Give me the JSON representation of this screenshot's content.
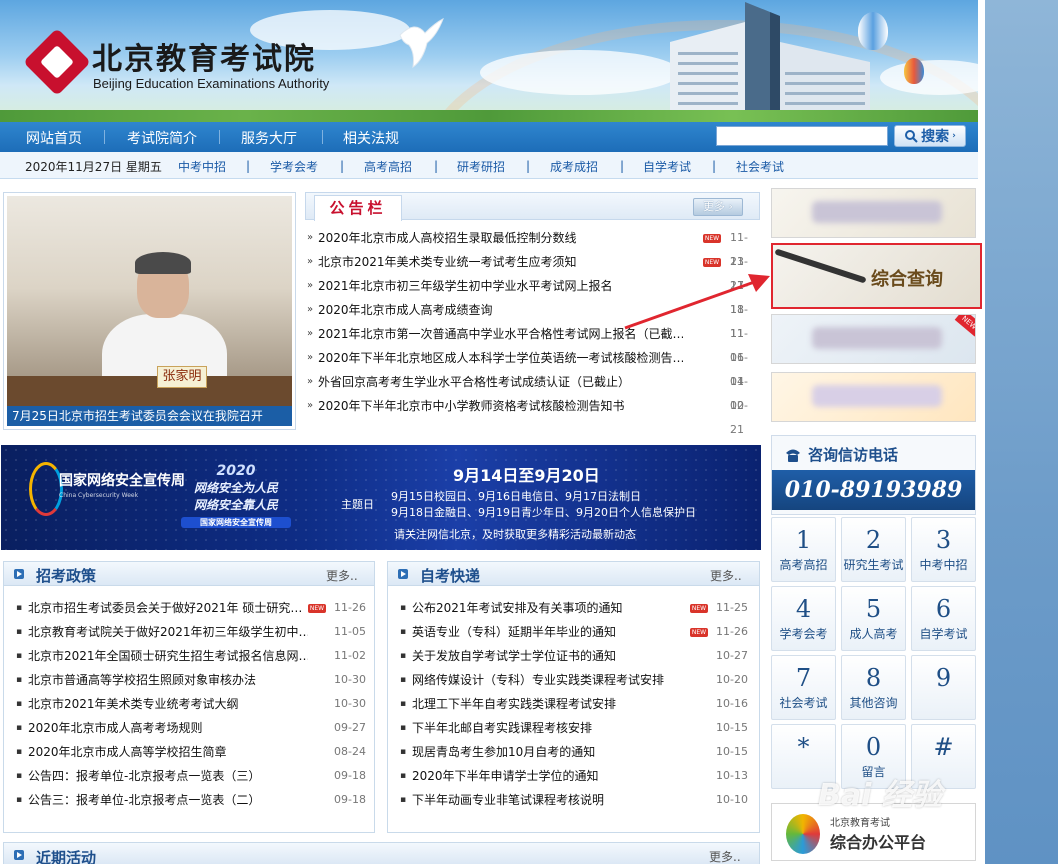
{
  "header": {
    "logo_cn": "北京教育考试院",
    "logo_en": "Beijing Education Examinations Authority"
  },
  "nav": {
    "items": [
      "网站首页",
      "考试院简介",
      "服务大厅",
      "相关法规"
    ],
    "search_placeholder": "",
    "search_label": "搜索"
  },
  "subnav": {
    "date": "2020年11月27日 星期五",
    "items": [
      "中考中招",
      "学考会考",
      "高考高招",
      "研考研招",
      "成考成招",
      "自学考试",
      "社会考试"
    ]
  },
  "photo": {
    "nameplate": "张家明",
    "caption": "7月25日北京市招生考试委员会会议在我院召开"
  },
  "bulletin": {
    "title": "公告栏",
    "more": "更多",
    "items": [
      {
        "title": "2020年北京市成人高校招生录取最低控制分数线",
        "date": "11-23",
        "new": true
      },
      {
        "title": "北京市2021年美术类专业统一考试考生应考须知",
        "date": "11-27",
        "new": true
      },
      {
        "title": "2021年北京市初三年级学生初中学业水平考试网上报名",
        "date": "11-18",
        "new": false
      },
      {
        "title": "2020年北京市成人高考成绩查询",
        "date": "11-11",
        "new": false
      },
      {
        "title": "2021年北京市第一次普通高中学业水平合格性考试网上报名（已截…",
        "date": "11-06",
        "new": false
      },
      {
        "title": "2020年下半年北京地区成人本科学士学位英语统一考试核酸检测告…",
        "date": "11-04",
        "new": false
      },
      {
        "title": "外省回京高考考生学业水平合格性考试成绩认证（已截止）",
        "date": "11-02",
        "new": false
      },
      {
        "title": "2020年下半年北京市中小学教师资格考试核酸检测告知书",
        "date": "10-21",
        "new": false
      }
    ]
  },
  "right_cards": {
    "query_label": "综合查询",
    "new_tag": "NEW"
  },
  "ad": {
    "logo1": "国家网络安全宣传周",
    "logo1_sub": "China Cybersecurity Week",
    "logo2_year": "2020",
    "logo2_line1": "网络安全为人民",
    "logo2_line2": "网络安全靠人民",
    "logo2_bar": "国家网络安全宣传周",
    "date_range": "9月14日至9月20日",
    "topic_label": "主题日",
    "line1": "9月15日校园日、9月16日电信日、9月17日法制日",
    "line2": "9月18日金融日、9月19日青少年日、9月20日个人信息保护日",
    "footer": "请关注网信北京，及时获取更多精彩活动最新动态"
  },
  "hotline": {
    "title": "咨询信访电话",
    "number": "010-89193989"
  },
  "keypad": [
    {
      "n": "1",
      "l": "高考高招"
    },
    {
      "n": "2",
      "l": "研究生考试"
    },
    {
      "n": "3",
      "l": "中考中招"
    },
    {
      "n": "4",
      "l": "学考会考"
    },
    {
      "n": "5",
      "l": "成人高考"
    },
    {
      "n": "6",
      "l": "自学考试"
    },
    {
      "n": "7",
      "l": "社会考试"
    },
    {
      "n": "8",
      "l": "其他咨询"
    },
    {
      "n": "9",
      "l": ""
    },
    {
      "n": "*",
      "l": ""
    },
    {
      "n": "0",
      "l": "留言"
    },
    {
      "n": "#",
      "l": ""
    }
  ],
  "platform": {
    "line1": "北京教育考试",
    "line2": "综合办公平台"
  },
  "policy": {
    "title": "招考政策",
    "more": "更多..",
    "items": [
      {
        "title": "北京市招生考试委员会关于做好2021年 硕士研究…",
        "date": "11-26",
        "new": true
      },
      {
        "title": "北京教育考试院关于做好2021年初三年级学生初中…",
        "date": "11-05",
        "new": false
      },
      {
        "title": "北京市2021年全国硕士研究生招生考试报名信息网…",
        "date": "11-02",
        "new": false
      },
      {
        "title": "北京市普通高等学校招生照顾对象审核办法",
        "date": "10-30",
        "new": false
      },
      {
        "title": "北京市2021年美术类专业统考考试大纲",
        "date": "10-30",
        "new": false
      },
      {
        "title": "2020年北京市成人高考考场规则",
        "date": "09-27",
        "new": false
      },
      {
        "title": "2020年北京市成人高等学校招生简章",
        "date": "08-24",
        "new": false
      },
      {
        "title": "公告四：报考单位-北京报考点一览表（三）",
        "date": "09-18",
        "new": false
      },
      {
        "title": "公告三：报考单位-北京报考点一览表（二）",
        "date": "09-18",
        "new": false
      }
    ]
  },
  "self_exam": {
    "title": "自考快递",
    "more": "更多..",
    "items": [
      {
        "title": "公布2021年考试安排及有关事项的通知",
        "date": "11-25",
        "new": true
      },
      {
        "title": "英语专业（专科）延期半年毕业的通知",
        "date": "11-26",
        "new": true
      },
      {
        "title": "关于发放自学考试学士学位证书的通知",
        "date": "10-27",
        "new": false
      },
      {
        "title": "网络传媒设计（专科）专业实践类课程考试安排",
        "date": "10-20",
        "new": false
      },
      {
        "title": "北理工下半年自考实践类课程考试安排",
        "date": "10-16",
        "new": false
      },
      {
        "title": "下半年北邮自考实践课程考核安排",
        "date": "10-15",
        "new": false
      },
      {
        "title": "现居青岛考生参加10月自考的通知",
        "date": "10-15",
        "new": false
      },
      {
        "title": "2020年下半年申请学士学位的通知",
        "date": "10-13",
        "new": false
      },
      {
        "title": "下半年动画专业非笔试课程考核说明",
        "date": "10-10",
        "new": false
      }
    ]
  },
  "recent": {
    "title": "近期活动",
    "more": "更多.."
  },
  "watermark": "Bai 经验",
  "colors": {
    "nav_blue": "#1d6db8",
    "accent_red": "#c8102e",
    "link_blue": "#1a5aa6"
  }
}
